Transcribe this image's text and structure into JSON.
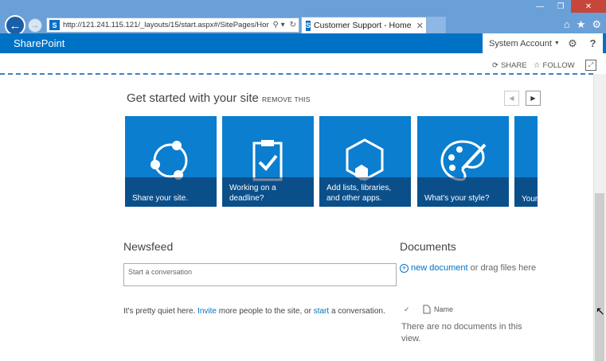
{
  "browser": {
    "url": "http://121.241.115.121/_layouts/15/start.aspx#/SitePages/Hor",
    "tab_title": "Customer Support - Home",
    "window_buttons": [
      "—",
      "❐",
      "✕"
    ]
  },
  "suitebar": {
    "brand": "SharePoint",
    "account": "System Account",
    "gear": "⚙",
    "help": "?"
  },
  "actions": {
    "share": "SHARE",
    "follow": "FOLLOW"
  },
  "get_started": {
    "title": "Get started with your site",
    "remove": "REMOVE THIS",
    "tiles": [
      {
        "label1": "Share your site.",
        "label2": ""
      },
      {
        "label1": "Working on a",
        "label2": "deadline?"
      },
      {
        "label1": "Add lists, libraries,",
        "label2": "and other apps."
      },
      {
        "label1": "What's your style?",
        "label2": ""
      },
      {
        "label1": "Your",
        "label2": ""
      }
    ]
  },
  "newsfeed": {
    "title": "Newsfeed",
    "placeholder": "Start a conversation",
    "quiet_pre": "It's pretty quiet here. ",
    "invite": "Invite",
    "quiet_mid": " more people to the site, or ",
    "start": "start",
    "quiet_post": " a conversation."
  },
  "documents": {
    "title": "Documents",
    "new_document": "new document",
    "drag": " or drag files here",
    "col_check": "✓",
    "col_name": "Name",
    "empty": "There are no documents in this view."
  }
}
